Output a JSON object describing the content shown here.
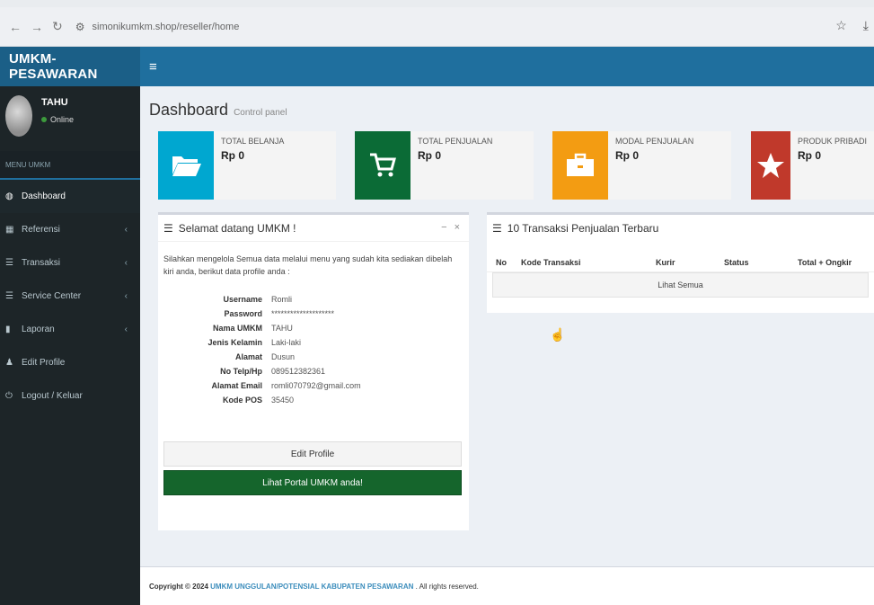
{
  "browser": {
    "url": "simonikumkm.shop/reseller/home"
  },
  "header": {
    "brand": "UMKM-PESAWARAN",
    "menu_icon": "≡"
  },
  "sidebar": {
    "user_name": "TAHU",
    "user_status": "Online",
    "menu_header": "MENU UMKM",
    "items": [
      {
        "label": "Dashboard",
        "icon": "dashboard-icon"
      },
      {
        "label": "Referensi",
        "icon": "grid-icon"
      },
      {
        "label": "Transaksi",
        "icon": "list-icon"
      },
      {
        "label": "Service Center",
        "icon": "list-icon"
      },
      {
        "label": "Laporan",
        "icon": "book-icon"
      },
      {
        "label": "Edit Profile",
        "icon": "user-icon"
      },
      {
        "label": "Logout / Keluar",
        "icon": "power-icon"
      }
    ]
  },
  "page": {
    "title": "Dashboard",
    "subtitle": "Control panel"
  },
  "info_boxes": [
    {
      "label": "TOTAL BELANJA",
      "value": "Rp 0",
      "color": "#00a7d0",
      "icon": "folder-open-icon"
    },
    {
      "label": "TOTAL PENJUALAN",
      "value": "Rp 0",
      "color": "#0b6b36",
      "icon": "cart-icon"
    },
    {
      "label": "MODAL PENJUALAN",
      "value": "Rp 0",
      "color": "#f39c12",
      "icon": "briefcase-icon"
    },
    {
      "label": "PRODUK PRIBADI",
      "value": "Rp 0",
      "color": "#c0392b",
      "icon": "star-icon"
    }
  ],
  "welcome": {
    "title": "Selamat datang UMKM !",
    "intro": "Silahkan mengelola Semua data melalui menu yang sudah kita sediakan dibelah kiri anda, berikut data profile anda :",
    "profile": [
      {
        "label": "Username",
        "value": "Romli"
      },
      {
        "label": "Password",
        "value": "********************"
      },
      {
        "label": "Nama UMKM",
        "value": "TAHU"
      },
      {
        "label": "Jenis Kelamin",
        "value": "Laki-laki"
      },
      {
        "label": "Alamat",
        "value": "Dusun"
      },
      {
        "label": "No Telp/Hp",
        "value": "089512382361"
      },
      {
        "label": "Alamat Email",
        "value": "romli070792@gmail.com"
      },
      {
        "label": "Kode POS",
        "value": "35450"
      }
    ],
    "edit_button": "Edit Profile",
    "portal_button": "Lihat Portal UMKM anda!"
  },
  "transactions": {
    "title": "10 Transaksi Penjualan Terbaru",
    "columns": [
      "No",
      "Kode Transaksi",
      "Kurir",
      "Status",
      "Total + Ongkir"
    ],
    "view_all": "Lihat Semua"
  },
  "footer": {
    "prefix": "Copyright © 2024",
    "org": "UMKM UNGGULAN/POTENSIAL KABUPATEN PESAWARAN",
    "suffix": ". All rights reserved."
  }
}
